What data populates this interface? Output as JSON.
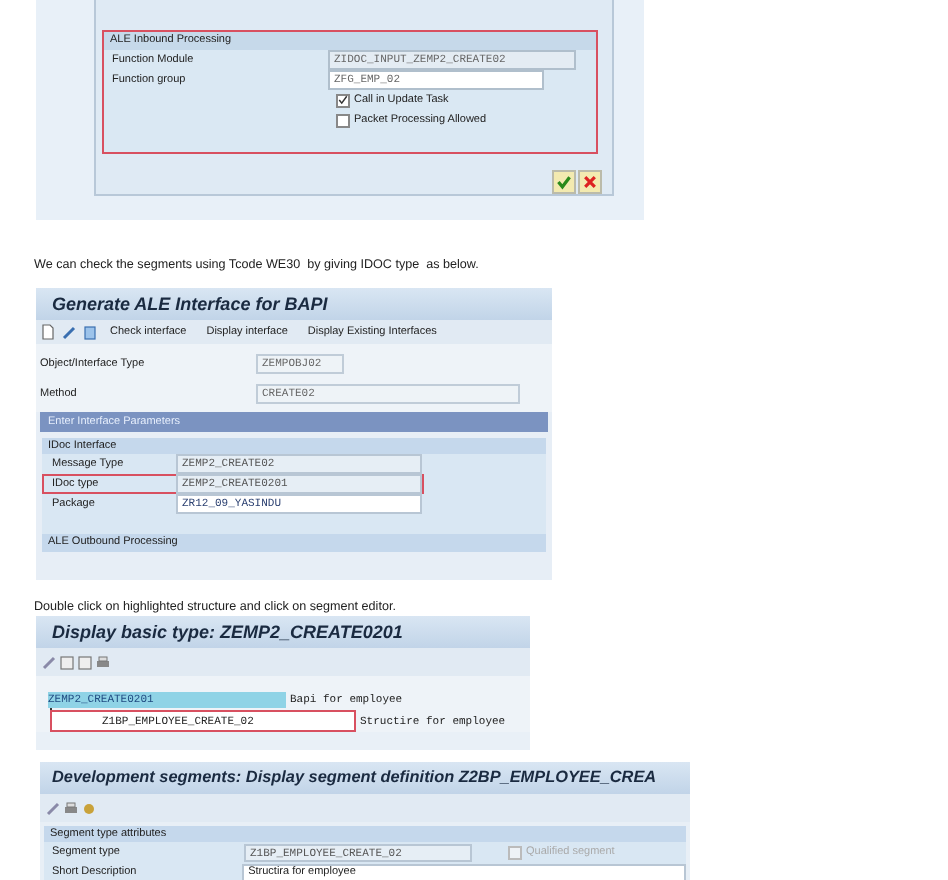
{
  "ale_dialog": {
    "group_title": "ALE Inbound Processing",
    "highlighted": true,
    "fields": [
      {
        "label": "Function Module",
        "value": "ZIDOC_INPUT_ZEMP2_CREATE02",
        "editable": false
      },
      {
        "label": "Function group",
        "value": "ZFG_EMP_02",
        "editable": true
      }
    ],
    "checkboxes": [
      {
        "label": "Call in Update Task",
        "checked": true
      },
      {
        "label": "Packet Processing Allowed",
        "checked": false
      }
    ]
  },
  "paragraph_1": "We can check the segments using Tcode WE30  by giving IDOC type  as below.",
  "generate_screen": {
    "title": "Generate ALE Interface for BAPI",
    "toolbar": [
      {
        "kind": "new"
      },
      {
        "kind": "edit"
      },
      {
        "kind": "delete"
      },
      {
        "kind": "text",
        "label": "Check interface"
      },
      {
        "kind": "text",
        "label": "Display interface"
      },
      {
        "kind": "text",
        "label": "Display Existing Interfaces"
      }
    ],
    "top_fields": [
      {
        "label": "Object/Interface Type",
        "value": "ZEMPOBJ02",
        "wide": false
      },
      {
        "label": "Method",
        "value": "CREATE02",
        "wide": true
      }
    ],
    "section_bar": "Enter Interface Parameters",
    "idoc_group": "IDoc Interface",
    "idoc_fields": [
      {
        "label": "Message Type",
        "value": "ZEMP2_CREATE02",
        "highlighted": false,
        "selected": false
      },
      {
        "label": "IDoc type",
        "value": "ZEMP2_CREATE0201",
        "highlighted": true,
        "selected": false
      },
      {
        "label": "Package",
        "value": "ZR12_09_YASINDU",
        "highlighted": false,
        "selected": true
      }
    ],
    "outbound_group": "ALE Outbound Processing"
  },
  "paragraph_2": "Double click on highlighted structure and click on segment editor.",
  "basic_type_screen": {
    "title": "Display basic type: ZEMP2_CREATE0201",
    "tree": [
      {
        "name": "ZEMP2_CREATE0201",
        "description": "Bapi for employee",
        "selected": true,
        "highlighted": false,
        "children": [
          {
            "name": "Z1BP_EMPLOYEE_CREATE_02",
            "description": "Structire for employee",
            "selected": false,
            "highlighted": true
          }
        ]
      }
    ]
  },
  "segment_screen": {
    "title": "Development segments: Display segment definition Z2BP_EMPLOYEE_CREA",
    "group_title": "Segment type attributes",
    "segment_type": {
      "label": "Segment type",
      "value": "Z1BP_EMPLOYEE_CREATE_02"
    },
    "qualified": {
      "label": "Qualified segment",
      "checked": false,
      "disabled": true
    },
    "short_description": {
      "label": "Short Description",
      "value": "Structira for employee"
    }
  }
}
